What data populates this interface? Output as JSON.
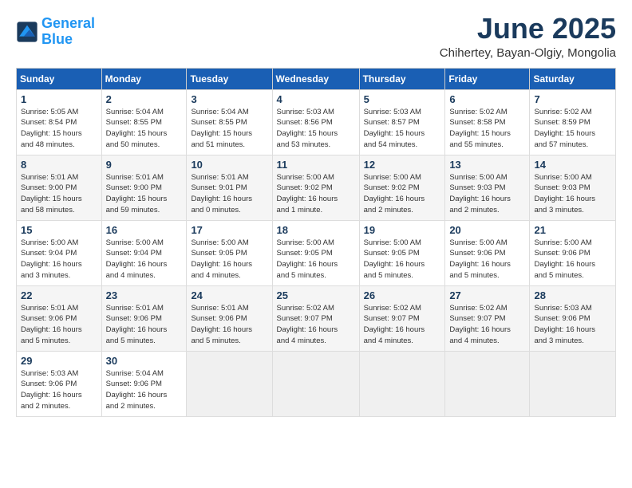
{
  "header": {
    "logo_line1": "General",
    "logo_line2": "Blue",
    "month": "June 2025",
    "location": "Chihertey, Bayan-Olgiy, Mongolia"
  },
  "weekdays": [
    "Sunday",
    "Monday",
    "Tuesday",
    "Wednesday",
    "Thursday",
    "Friday",
    "Saturday"
  ],
  "weeks": [
    [
      {
        "day": "1",
        "info": "Sunrise: 5:05 AM\nSunset: 8:54 PM\nDaylight: 15 hours\nand 48 minutes."
      },
      {
        "day": "2",
        "info": "Sunrise: 5:04 AM\nSunset: 8:55 PM\nDaylight: 15 hours\nand 50 minutes."
      },
      {
        "day": "3",
        "info": "Sunrise: 5:04 AM\nSunset: 8:55 PM\nDaylight: 15 hours\nand 51 minutes."
      },
      {
        "day": "4",
        "info": "Sunrise: 5:03 AM\nSunset: 8:56 PM\nDaylight: 15 hours\nand 53 minutes."
      },
      {
        "day": "5",
        "info": "Sunrise: 5:03 AM\nSunset: 8:57 PM\nDaylight: 15 hours\nand 54 minutes."
      },
      {
        "day": "6",
        "info": "Sunrise: 5:02 AM\nSunset: 8:58 PM\nDaylight: 15 hours\nand 55 minutes."
      },
      {
        "day": "7",
        "info": "Sunrise: 5:02 AM\nSunset: 8:59 PM\nDaylight: 15 hours\nand 57 minutes."
      }
    ],
    [
      {
        "day": "8",
        "info": "Sunrise: 5:01 AM\nSunset: 9:00 PM\nDaylight: 15 hours\nand 58 minutes."
      },
      {
        "day": "9",
        "info": "Sunrise: 5:01 AM\nSunset: 9:00 PM\nDaylight: 15 hours\nand 59 minutes."
      },
      {
        "day": "10",
        "info": "Sunrise: 5:01 AM\nSunset: 9:01 PM\nDaylight: 16 hours\nand 0 minutes."
      },
      {
        "day": "11",
        "info": "Sunrise: 5:00 AM\nSunset: 9:02 PM\nDaylight: 16 hours\nand 1 minute."
      },
      {
        "day": "12",
        "info": "Sunrise: 5:00 AM\nSunset: 9:02 PM\nDaylight: 16 hours\nand 2 minutes."
      },
      {
        "day": "13",
        "info": "Sunrise: 5:00 AM\nSunset: 9:03 PM\nDaylight: 16 hours\nand 2 minutes."
      },
      {
        "day": "14",
        "info": "Sunrise: 5:00 AM\nSunset: 9:03 PM\nDaylight: 16 hours\nand 3 minutes."
      }
    ],
    [
      {
        "day": "15",
        "info": "Sunrise: 5:00 AM\nSunset: 9:04 PM\nDaylight: 16 hours\nand 3 minutes."
      },
      {
        "day": "16",
        "info": "Sunrise: 5:00 AM\nSunset: 9:04 PM\nDaylight: 16 hours\nand 4 minutes."
      },
      {
        "day": "17",
        "info": "Sunrise: 5:00 AM\nSunset: 9:05 PM\nDaylight: 16 hours\nand 4 minutes."
      },
      {
        "day": "18",
        "info": "Sunrise: 5:00 AM\nSunset: 9:05 PM\nDaylight: 16 hours\nand 5 minutes."
      },
      {
        "day": "19",
        "info": "Sunrise: 5:00 AM\nSunset: 9:05 PM\nDaylight: 16 hours\nand 5 minutes."
      },
      {
        "day": "20",
        "info": "Sunrise: 5:00 AM\nSunset: 9:06 PM\nDaylight: 16 hours\nand 5 minutes."
      },
      {
        "day": "21",
        "info": "Sunrise: 5:00 AM\nSunset: 9:06 PM\nDaylight: 16 hours\nand 5 minutes."
      }
    ],
    [
      {
        "day": "22",
        "info": "Sunrise: 5:01 AM\nSunset: 9:06 PM\nDaylight: 16 hours\nand 5 minutes."
      },
      {
        "day": "23",
        "info": "Sunrise: 5:01 AM\nSunset: 9:06 PM\nDaylight: 16 hours\nand 5 minutes."
      },
      {
        "day": "24",
        "info": "Sunrise: 5:01 AM\nSunset: 9:06 PM\nDaylight: 16 hours\nand 5 minutes."
      },
      {
        "day": "25",
        "info": "Sunrise: 5:02 AM\nSunset: 9:07 PM\nDaylight: 16 hours\nand 4 minutes."
      },
      {
        "day": "26",
        "info": "Sunrise: 5:02 AM\nSunset: 9:07 PM\nDaylight: 16 hours\nand 4 minutes."
      },
      {
        "day": "27",
        "info": "Sunrise: 5:02 AM\nSunset: 9:07 PM\nDaylight: 16 hours\nand 4 minutes."
      },
      {
        "day": "28",
        "info": "Sunrise: 5:03 AM\nSunset: 9:06 PM\nDaylight: 16 hours\nand 3 minutes."
      }
    ],
    [
      {
        "day": "29",
        "info": "Sunrise: 5:03 AM\nSunset: 9:06 PM\nDaylight: 16 hours\nand 2 minutes."
      },
      {
        "day": "30",
        "info": "Sunrise: 5:04 AM\nSunset: 9:06 PM\nDaylight: 16 hours\nand 2 minutes."
      },
      {
        "day": "",
        "info": ""
      },
      {
        "day": "",
        "info": ""
      },
      {
        "day": "",
        "info": ""
      },
      {
        "day": "",
        "info": ""
      },
      {
        "day": "",
        "info": ""
      }
    ]
  ]
}
